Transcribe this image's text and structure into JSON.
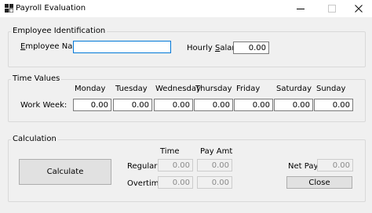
{
  "window": {
    "title": "Payroll Evaluation",
    "icons": {
      "app": "app-icon",
      "minimize": "minimize-icon",
      "maximize": "maximize-icon",
      "close": "close-icon"
    }
  },
  "employee": {
    "group_label": "Employee Identification",
    "name_label": "Employee Name:",
    "name_value": "",
    "salary_label_pre": "Hourly ",
    "salary_label_accel": "S",
    "salary_label_post": "alary:",
    "salary_value": "0.00"
  },
  "time_values": {
    "group_label": "Time Values",
    "row_label": "Work Week:",
    "days": [
      {
        "name": "Monday",
        "value": "0.00"
      },
      {
        "name": "Tuesday",
        "value": "0.00"
      },
      {
        "name": "Wednesday",
        "value": "0.00"
      },
      {
        "name": "Thursday",
        "value": "0.00"
      },
      {
        "name": "Friday",
        "value": "0.00"
      },
      {
        "name": "Saturday",
        "value": "0.00"
      },
      {
        "name": "Sunday",
        "value": "0.00"
      }
    ]
  },
  "calculation": {
    "group_label": "Calculation",
    "calculate_label": "Calculate",
    "time_header": "Time",
    "pay_header": "Pay Amt",
    "regular_label": "Regular:",
    "overtime_label": "Overtime:",
    "regular_time": "0.00",
    "regular_pay": "0.00",
    "overtime_time": "0.00",
    "overtime_pay": "0.00",
    "net_pay_label": "Net Pay:",
    "net_pay_value": "0.00",
    "close_label": "Close"
  }
}
